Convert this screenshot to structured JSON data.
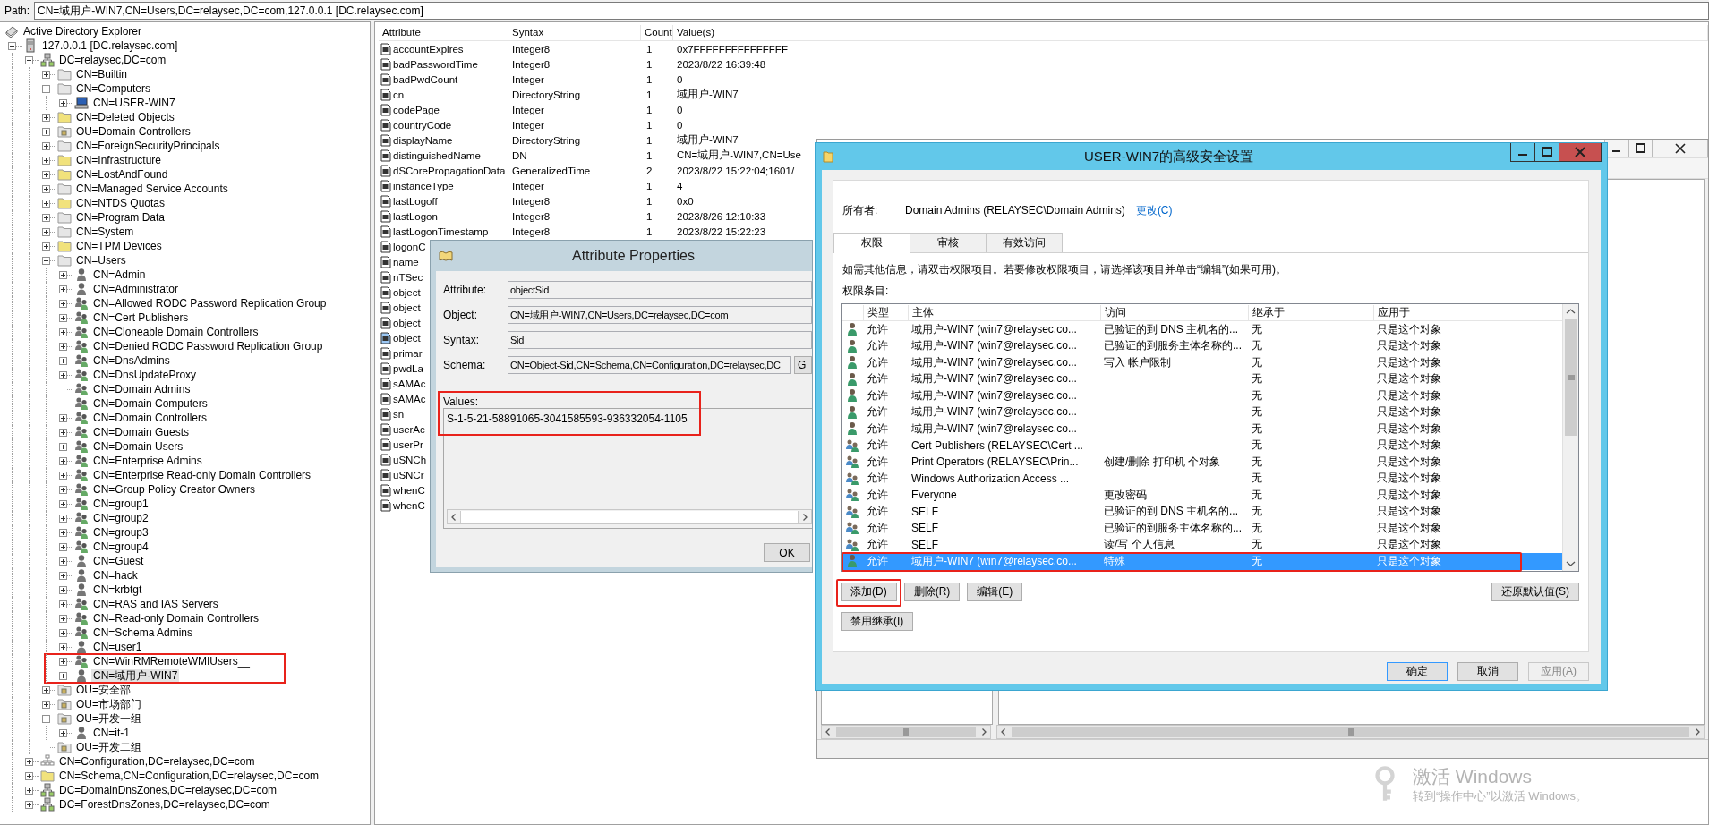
{
  "path_bar": {
    "label": "Path:",
    "value": "CN=域用户-WIN7,CN=Users,DC=relaysec,DC=com,127.0.0.1 [DC.relaysec.com]"
  },
  "tree": {
    "items": [
      {
        "label": "Active Directory Explorer",
        "kind": "explorer",
        "expandable": false,
        "expanded": true,
        "selected": false,
        "highlighted": false,
        "children": [
          {
            "label": "127.0.0.1 [DC.relaysec.com]",
            "kind": "server",
            "expandable": true,
            "expanded": true,
            "selected": false,
            "highlighted": false,
            "children": [
              {
                "label": "DC=relaysec,DC=com",
                "kind": "domain",
                "expandable": true,
                "expanded": true,
                "selected": false,
                "highlighted": false,
                "children": [
                  {
                    "label": "CN=Builtin",
                    "kind": "folder",
                    "expandable": true,
                    "expanded": false,
                    "selected": false,
                    "highlighted": false
                  },
                  {
                    "label": "CN=Computers",
                    "kind": "folder",
                    "expandable": true,
                    "expanded": true,
                    "selected": false,
                    "highlighted": false,
                    "children": [
                      {
                        "label": "CN=USER-WIN7",
                        "kind": "computer",
                        "expandable": true,
                        "expanded": false,
                        "selected": false,
                        "highlighted": false
                      }
                    ]
                  },
                  {
                    "label": "CN=Deleted Objects",
                    "kind": "folder-yellow",
                    "expandable": true,
                    "expanded": false,
                    "selected": false,
                    "highlighted": false
                  },
                  {
                    "label": "OU=Domain Controllers",
                    "kind": "ou",
                    "expandable": true,
                    "expanded": false,
                    "selected": false,
                    "highlighted": false
                  },
                  {
                    "label": "CN=ForeignSecurityPrincipals",
                    "kind": "folder",
                    "expandable": true,
                    "expanded": false,
                    "selected": false,
                    "highlighted": false
                  },
                  {
                    "label": "CN=Infrastructure",
                    "kind": "folder-yellow",
                    "expandable": true,
                    "expanded": false,
                    "selected": false,
                    "highlighted": false
                  },
                  {
                    "label": "CN=LostAndFound",
                    "kind": "folder-yellow",
                    "expandable": true,
                    "expanded": false,
                    "selected": false,
                    "highlighted": false
                  },
                  {
                    "label": "CN=Managed Service Accounts",
                    "kind": "folder",
                    "expandable": true,
                    "expanded": false,
                    "selected": false,
                    "highlighted": false
                  },
                  {
                    "label": "CN=NTDS Quotas",
                    "kind": "folder-yellow",
                    "expandable": true,
                    "expanded": false,
                    "selected": false,
                    "highlighted": false
                  },
                  {
                    "label": "CN=Program Data",
                    "kind": "folder",
                    "expandable": true,
                    "expanded": false,
                    "selected": false,
                    "highlighted": false
                  },
                  {
                    "label": "CN=System",
                    "kind": "folder",
                    "expandable": true,
                    "expanded": false,
                    "selected": false,
                    "highlighted": false
                  },
                  {
                    "label": "CN=TPM Devices",
                    "kind": "folder-yellow",
                    "expandable": true,
                    "expanded": false,
                    "selected": false,
                    "highlighted": false
                  },
                  {
                    "label": "CN=Users",
                    "kind": "folder",
                    "expandable": true,
                    "expanded": true,
                    "selected": false,
                    "highlighted": false,
                    "children": [
                      {
                        "label": "CN=Admin",
                        "kind": "user",
                        "expandable": true,
                        "expanded": false,
                        "selected": false,
                        "highlighted": false
                      },
                      {
                        "label": "CN=Administrator",
                        "kind": "user",
                        "expandable": true,
                        "expanded": false,
                        "selected": false,
                        "highlighted": false
                      },
                      {
                        "label": "CN=Allowed RODC Password Replication Group",
                        "kind": "group",
                        "expandable": true,
                        "expanded": false,
                        "selected": false,
                        "highlighted": false
                      },
                      {
                        "label": "CN=Cert Publishers",
                        "kind": "group",
                        "expandable": true,
                        "expanded": false,
                        "selected": false,
                        "highlighted": false
                      },
                      {
                        "label": "CN=Cloneable Domain Controllers",
                        "kind": "group",
                        "expandable": true,
                        "expanded": false,
                        "selected": false,
                        "highlighted": false
                      },
                      {
                        "label": "CN=Denied RODC Password Replication Group",
                        "kind": "group",
                        "expandable": true,
                        "expanded": false,
                        "selected": false,
                        "highlighted": false
                      },
                      {
                        "label": "CN=DnsAdmins",
                        "kind": "group",
                        "expandable": true,
                        "expanded": false,
                        "selected": false,
                        "highlighted": false
                      },
                      {
                        "label": "CN=DnsUpdateProxy",
                        "kind": "group",
                        "expandable": true,
                        "expanded": false,
                        "selected": false,
                        "highlighted": false
                      },
                      {
                        "label": "CN=Domain Admins",
                        "kind": "group",
                        "expandable": false,
                        "selected": false,
                        "highlighted": false
                      },
                      {
                        "label": "CN=Domain Computers",
                        "kind": "group",
                        "expandable": false,
                        "selected": false,
                        "highlighted": false
                      },
                      {
                        "label": "CN=Domain Controllers",
                        "kind": "group",
                        "expandable": true,
                        "expanded": false,
                        "selected": false,
                        "highlighted": false
                      },
                      {
                        "label": "CN=Domain Guests",
                        "kind": "group",
                        "expandable": true,
                        "expanded": false,
                        "selected": false,
                        "highlighted": false
                      },
                      {
                        "label": "CN=Domain Users",
                        "kind": "group",
                        "expandable": true,
                        "expanded": false,
                        "selected": false,
                        "highlighted": false
                      },
                      {
                        "label": "CN=Enterprise Admins",
                        "kind": "group",
                        "expandable": true,
                        "expanded": false,
                        "selected": false,
                        "highlighted": false
                      },
                      {
                        "label": "CN=Enterprise Read-only Domain Controllers",
                        "kind": "group",
                        "expandable": true,
                        "expanded": false,
                        "selected": false,
                        "highlighted": false
                      },
                      {
                        "label": "CN=Group Policy Creator Owners",
                        "kind": "group",
                        "expandable": true,
                        "expanded": false,
                        "selected": false,
                        "highlighted": false
                      },
                      {
                        "label": "CN=group1",
                        "kind": "group",
                        "expandable": true,
                        "expanded": false,
                        "selected": false,
                        "highlighted": false
                      },
                      {
                        "label": "CN=group2",
                        "kind": "group",
                        "expandable": true,
                        "expanded": false,
                        "selected": false,
                        "highlighted": false
                      },
                      {
                        "label": "CN=group3",
                        "kind": "group",
                        "expandable": true,
                        "expanded": false,
                        "selected": false,
                        "highlighted": false
                      },
                      {
                        "label": "CN=group4",
                        "kind": "group",
                        "expandable": true,
                        "expanded": false,
                        "selected": false,
                        "highlighted": false
                      },
                      {
                        "label": "CN=Guest",
                        "kind": "user",
                        "expandable": true,
                        "expanded": false,
                        "selected": false,
                        "highlighted": false
                      },
                      {
                        "label": "CN=hack",
                        "kind": "user",
                        "expandable": true,
                        "expanded": false,
                        "selected": false,
                        "highlighted": false
                      },
                      {
                        "label": "CN=krbtgt",
                        "kind": "user",
                        "expandable": true,
                        "expanded": false,
                        "selected": false,
                        "highlighted": false
                      },
                      {
                        "label": "CN=RAS and IAS Servers",
                        "kind": "group",
                        "expandable": true,
                        "expanded": false,
                        "selected": false,
                        "highlighted": false
                      },
                      {
                        "label": "CN=Read-only Domain Controllers",
                        "kind": "group",
                        "expandable": true,
                        "expanded": false,
                        "selected": false,
                        "highlighted": false
                      },
                      {
                        "label": "CN=Schema Admins",
                        "kind": "group",
                        "expandable": true,
                        "expanded": false,
                        "selected": false,
                        "highlighted": false
                      },
                      {
                        "label": "CN=user1",
                        "kind": "user",
                        "expandable": true,
                        "expanded": false,
                        "selected": false,
                        "highlighted": false
                      },
                      {
                        "label": "CN=WinRMRemoteWMIUsers__",
                        "kind": "group",
                        "expandable": true,
                        "expanded": false,
                        "selected": false,
                        "highlighted": true
                      },
                      {
                        "label": "CN=域用户-WIN7",
                        "kind": "user",
                        "expandable": true,
                        "expanded": false,
                        "selected": true,
                        "highlighted": true
                      }
                    ]
                  },
                  {
                    "label": "OU=安全部",
                    "kind": "ou",
                    "expandable": true,
                    "expanded": false,
                    "selected": false,
                    "highlighted": false
                  },
                  {
                    "label": "OU=市场部门",
                    "kind": "ou",
                    "expandable": true,
                    "expanded": false,
                    "selected": false,
                    "highlighted": false
                  },
                  {
                    "label": "OU=开发一组",
                    "kind": "ou",
                    "expandable": true,
                    "expanded": true,
                    "selected": false,
                    "highlighted": false,
                    "children": [
                      {
                        "label": "CN=it-1",
                        "kind": "user",
                        "expandable": true,
                        "expanded": false,
                        "selected": false,
                        "highlighted": false
                      }
                    ]
                  },
                  {
                    "label": "OU=开发二组",
                    "kind": "ou",
                    "expandable": false,
                    "selected": false,
                    "highlighted": false
                  }
                ]
              },
              {
                "label": "CN=Configuration,DC=relaysec,DC=com",
                "kind": "config",
                "expandable": true,
                "expanded": false,
                "selected": false,
                "highlighted": false
              },
              {
                "label": "CN=Schema,CN=Configuration,DC=relaysec,DC=com",
                "kind": "folder-yellow",
                "expandable": true,
                "expanded": false,
                "selected": false,
                "highlighted": false
              },
              {
                "label": "DC=DomainDnsZones,DC=relaysec,DC=com",
                "kind": "domain",
                "expandable": true,
                "expanded": false,
                "selected": false,
                "highlighted": false
              },
              {
                "label": "DC=ForestDnsZones,DC=relaysec,DC=com",
                "kind": "domain",
                "expandable": true,
                "expanded": false,
                "selected": false,
                "highlighted": false
              }
            ]
          }
        ]
      }
    ]
  },
  "attributes": {
    "columns": [
      "Attribute",
      "Syntax",
      "Count",
      "Value(s)"
    ],
    "rows": [
      {
        "name": "accountExpires",
        "syntax": "Integer8",
        "count": "1",
        "value": "0x7FFFFFFFFFFFFFFF",
        "selected": false
      },
      {
        "name": "badPasswordTime",
        "syntax": "Integer8",
        "count": "1",
        "value": "2023/8/22 16:39:48",
        "selected": false
      },
      {
        "name": "badPwdCount",
        "syntax": "Integer",
        "count": "1",
        "value": "0",
        "selected": false
      },
      {
        "name": "cn",
        "syntax": "DirectoryString",
        "count": "1",
        "value": "域用户-WIN7",
        "selected": false
      },
      {
        "name": "codePage",
        "syntax": "Integer",
        "count": "1",
        "value": "0",
        "selected": false
      },
      {
        "name": "countryCode",
        "syntax": "Integer",
        "count": "1",
        "value": "0",
        "selected": false
      },
      {
        "name": "displayName",
        "syntax": "DirectoryString",
        "count": "1",
        "value": "域用户-WIN7",
        "selected": false
      },
      {
        "name": "distinguishedName",
        "syntax": "DN",
        "count": "1",
        "value": "CN=域用户-WIN7,CN=Use",
        "selected": false
      },
      {
        "name": "dSCorePropagationData",
        "syntax": "GeneralizedTime",
        "count": "2",
        "value": "2023/8/22 15:22:04;1601/",
        "selected": false
      },
      {
        "name": "instanceType",
        "syntax": "Integer",
        "count": "1",
        "value": "4",
        "selected": false
      },
      {
        "name": "lastLogoff",
        "syntax": "Integer8",
        "count": "1",
        "value": "0x0",
        "selected": false
      },
      {
        "name": "lastLogon",
        "syntax": "Integer8",
        "count": "1",
        "value": "2023/8/26 12:10:33",
        "selected": false
      },
      {
        "name": "lastLogonTimestamp",
        "syntax": "Integer8",
        "count": "1",
        "value": "2023/8/22 15:22:23",
        "selected": false
      },
      {
        "name": "logonC",
        "selected": false
      },
      {
        "name": "name",
        "selected": false
      },
      {
        "name": "nTSec",
        "selected": false
      },
      {
        "name": "object",
        "selected": false
      },
      {
        "name": "object",
        "selected": false
      },
      {
        "name": "object",
        "selected": false
      },
      {
        "name": "object",
        "selected": true
      },
      {
        "name": "primar",
        "selected": false
      },
      {
        "name": "pwdLa",
        "selected": false
      },
      {
        "name": "sAMAc",
        "selected": false
      },
      {
        "name": "sAMAc",
        "selected": false
      },
      {
        "name": "sn",
        "selected": false
      },
      {
        "name": "userAc",
        "selected": false
      },
      {
        "name": "userPr",
        "selected": false
      },
      {
        "name": "uSNCh",
        "selected": false
      },
      {
        "name": "uSNCr",
        "selected": false
      },
      {
        "name": "whenC",
        "selected": false
      },
      {
        "name": "whenC",
        "selected": false
      }
    ]
  },
  "attribute_dialog": {
    "title": "Attribute Properties",
    "fields": [
      {
        "label": "Attribute:",
        "value": "objectSid"
      },
      {
        "label": "Object:",
        "value": "CN=域用户-WIN7,CN=Users,DC=relaysec,DC=com"
      },
      {
        "label": "Syntax:",
        "value": "Sid"
      },
      {
        "label": "Schema:",
        "value": "CN=Object-Sid,CN=Schema,CN=Configuration,DC=relaysec,DC"
      }
    ],
    "go_button": "G",
    "values": {
      "label": "Values:",
      "items": [
        "S-1-5-21-58891065-3041585593-936332054-1105"
      ],
      "highlighted": true
    },
    "ok_button": "OK"
  },
  "security_dialog": {
    "title": "USER-WIN7的高级安全设置",
    "owner_label": "所有者:",
    "owner": "Domain Admins (RELAYSEC\\Domain Admins)",
    "change_link": "更改(C)",
    "tabs": [
      {
        "label": "权限",
        "selected": true
      },
      {
        "label": "审核",
        "selected": false
      },
      {
        "label": "有效访问",
        "selected": false
      }
    ],
    "info": "如需其他信息，请双击权限项目。若要修改权限项目，请选择该项目并单击“编辑”(如果可用)。",
    "entries_label": "权限条目:",
    "columns": [
      "类型",
      "主体",
      "访问",
      "继承于",
      "应用于"
    ],
    "entries": [
      {
        "kind": "user",
        "type": "允许",
        "principal": "域用户-WIN7 (win7@relaysec.co...",
        "access": "已验证的到 DNS 主机名的...",
        "inherited_from": "无",
        "applies_to": "只是这个对象",
        "selected": false,
        "highlighted": false
      },
      {
        "kind": "user",
        "type": "允许",
        "principal": "域用户-WIN7 (win7@relaysec.co...",
        "access": "已验证的到服务主体名称的...",
        "inherited_from": "无",
        "applies_to": "只是这个对象",
        "selected": false,
        "highlighted": false
      },
      {
        "kind": "user",
        "type": "允许",
        "principal": "域用户-WIN7 (win7@relaysec.co...",
        "access": "写入 帐户限制",
        "inherited_from": "无",
        "applies_to": "只是这个对象",
        "selected": false,
        "highlighted": false
      },
      {
        "kind": "user",
        "type": "允许",
        "principal": "域用户-WIN7 (win7@relaysec.co...",
        "inherited_from": "无",
        "applies_to": "只是这个对象",
        "selected": false,
        "highlighted": false
      },
      {
        "kind": "user",
        "type": "允许",
        "principal": "域用户-WIN7 (win7@relaysec.co...",
        "inherited_from": "无",
        "applies_to": "只是这个对象",
        "selected": false,
        "highlighted": false
      },
      {
        "kind": "user",
        "type": "允许",
        "principal": "域用户-WIN7 (win7@relaysec.co...",
        "inherited_from": "无",
        "applies_to": "只是这个对象",
        "selected": false,
        "highlighted": false
      },
      {
        "kind": "user",
        "type": "允许",
        "principal": "域用户-WIN7 (win7@relaysec.co...",
        "inherited_from": "无",
        "applies_to": "只是这个对象",
        "selected": false,
        "highlighted": false
      },
      {
        "kind": "group",
        "type": "允许",
        "principal": "Cert Publishers (RELAYSEC\\Cert ...",
        "inherited_from": "无",
        "applies_to": "只是这个对象",
        "selected": false,
        "highlighted": false
      },
      {
        "kind": "group",
        "type": "允许",
        "principal": "Print Operators (RELAYSEC\\Prin...",
        "access": "创建/删除 打印机 个对象",
        "inherited_from": "无",
        "applies_to": "只是这个对象",
        "selected": false,
        "highlighted": false
      },
      {
        "kind": "group",
        "type": "允许",
        "principal": "Windows Authorization Access ...",
        "inherited_from": "无",
        "applies_to": "只是这个对象",
        "selected": false,
        "highlighted": false
      },
      {
        "kind": "group",
        "type": "允许",
        "principal": "Everyone",
        "access": "更改密码",
        "inherited_from": "无",
        "applies_to": "只是这个对象",
        "selected": false,
        "highlighted": false
      },
      {
        "kind": "group",
        "type": "允许",
        "principal": "SELF",
        "access": "已验证的到 DNS 主机名的...",
        "inherited_from": "无",
        "applies_to": "只是这个对象",
        "selected": false,
        "highlighted": false
      },
      {
        "kind": "group",
        "type": "允许",
        "principal": "SELF",
        "access": "已验证的到服务主体名称的...",
        "inherited_from": "无",
        "applies_to": "只是这个对象",
        "selected": false,
        "highlighted": false
      },
      {
        "kind": "group",
        "type": "允许",
        "principal": "SELF",
        "access": "读/写 个人信息",
        "inherited_from": "无",
        "applies_to": "只是这个对象",
        "selected": false,
        "highlighted": false
      },
      {
        "kind": "user",
        "type": "允许",
        "principal": "域用户-WIN7 (win7@relaysec.co...",
        "access": "特殊",
        "inherited_from": "无",
        "applies_to": "只是这个对象",
        "selected": true,
        "highlighted": true
      }
    ],
    "list_actions": [
      {
        "label": "添加(D)",
        "highlighted": true
      },
      {
        "label": "删除(R)",
        "highlighted": false
      },
      {
        "label": "编辑(E)",
        "highlighted": false
      }
    ],
    "restore_button": "还原默认值(S)",
    "inheritance_button": "禁用继承(I)",
    "footer_buttons": [
      {
        "label": "确定",
        "default": true,
        "disabled": false
      },
      {
        "label": "取消",
        "default": false,
        "disabled": false
      },
      {
        "label": "应用(A)",
        "default": false,
        "disabled": true
      }
    ]
  },
  "activation_notice": {
    "title": "激活 Windows",
    "message": "转到“操作中心”以激活 Windows。"
  }
}
